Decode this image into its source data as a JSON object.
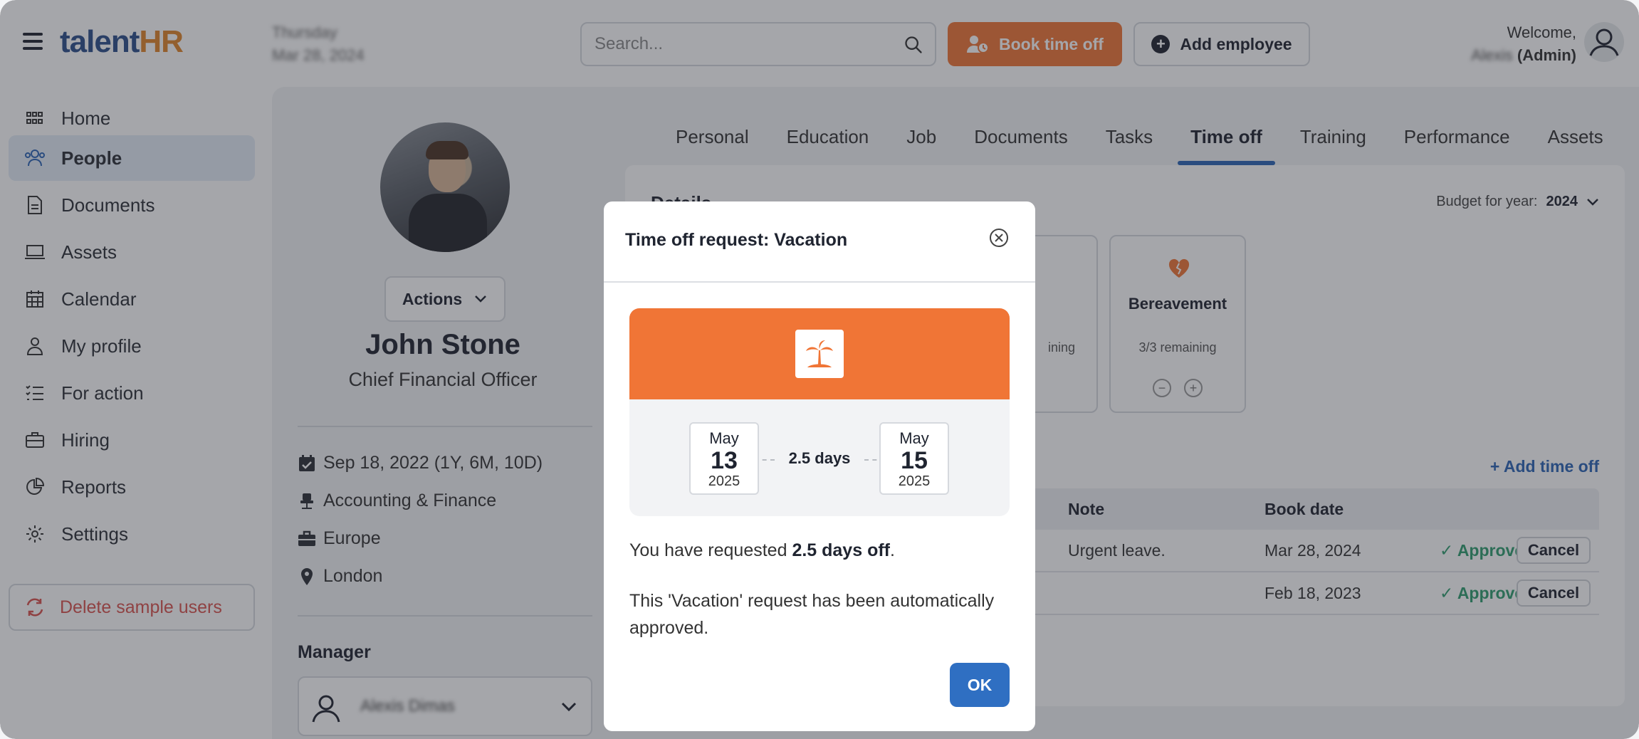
{
  "header": {
    "logo_main": "talent",
    "logo_accent": "HR",
    "date_day": "Thursday",
    "date_full": "Mar 28, 2024",
    "search_placeholder": "Search...",
    "book_time_off": "Book time off",
    "add_employee": "Add employee",
    "welcome": "Welcome,",
    "user_name": "Alexis",
    "user_role": "(Admin)"
  },
  "sidebar": {
    "items": [
      {
        "label": "Home",
        "icon": "grid-icon"
      },
      {
        "label": "People",
        "icon": "people-icon"
      },
      {
        "label": "Documents",
        "icon": "document-icon"
      },
      {
        "label": "Assets",
        "icon": "laptop-icon"
      },
      {
        "label": "Calendar",
        "icon": "calendar-icon"
      },
      {
        "label": "My profile",
        "icon": "user-icon"
      },
      {
        "label": "For action",
        "icon": "checklist-icon"
      },
      {
        "label": "Hiring",
        "icon": "briefcase-icon"
      },
      {
        "label": "Reports",
        "icon": "pie-chart-icon"
      },
      {
        "label": "Settings",
        "icon": "gear-icon"
      }
    ],
    "delete_label": "Delete sample users"
  },
  "profile": {
    "actions_label": "Actions",
    "name": "John Stone",
    "title": "Chief Financial Officer",
    "start_date": "Sep 18, 2022 (1Y, 6M, 10D)",
    "department": "Accounting & Finance",
    "region": "Europe",
    "location": "London",
    "manager_label": "Manager",
    "manager_name": "Alexis Dimas"
  },
  "tabs": [
    "Personal",
    "Education",
    "Job",
    "Documents",
    "Tasks",
    "Time off",
    "Training",
    "Performance",
    "Assets"
  ],
  "active_tab": "Time off",
  "details": {
    "title": "Details",
    "budget_label": "Budget for year:",
    "budget_year": "2024",
    "partial_card_remaining": "ining",
    "bereavement_name": "Bereavement",
    "bereavement_remaining": "3/3 remaining",
    "add_time_off": "+ Add time off",
    "columns": {
      "note": "Note",
      "book_date": "Book date"
    },
    "rows": [
      {
        "note": "Urgent leave.",
        "book_date": "Mar 28, 2024",
        "status": "Approved",
        "action": "Cancel"
      },
      {
        "note": "",
        "book_date": "Feb 18, 2023",
        "status": "Approved",
        "action": "Cancel"
      }
    ]
  },
  "modal": {
    "title": "Time off request: Vacation",
    "start": {
      "month": "May",
      "day": "13",
      "year": "2025"
    },
    "end": {
      "month": "May",
      "day": "15",
      "year": "2025"
    },
    "duration": "2.5 days",
    "requested_prefix": "You have requested ",
    "requested_amount": "2.5 days off",
    "requested_suffix": ".",
    "auto_text": "This 'Vacation' request has been automatically approved.",
    "ok_label": "OK"
  },
  "colors": {
    "accent_orange": "#f07536",
    "primary_blue": "#2f6fc2",
    "approved_green": "#2f9e6e",
    "danger_red": "#d9534f"
  }
}
